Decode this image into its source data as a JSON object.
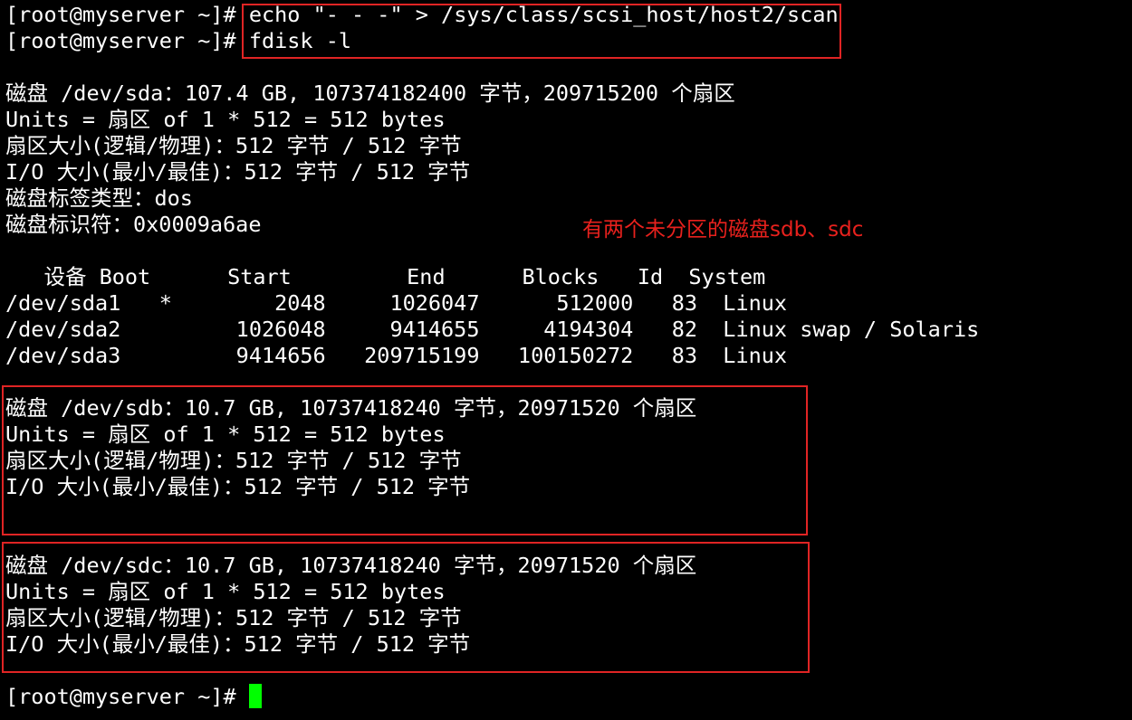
{
  "terminal": {
    "prompt": "[root@myserver ~]#",
    "commands": [
      "echo \"- - -\" > /sys/class/scsi_host/host2/scan",
      "fdisk -l"
    ],
    "sda": {
      "header": "磁盘 /dev/sda：107.4 GB, 107374182400 字节，209715200 个扇区",
      "units": "Units = 扇区 of 1 * 512 = 512 bytes",
      "sector_size": "扇区大小(逻辑/物理)：512 字节 / 512 字节",
      "io_size": "I/O 大小(最小/最佳)：512 字节 / 512 字节",
      "label_type": "磁盘标签类型：dos",
      "identifier": "磁盘标识符：0x0009a6ae"
    },
    "partition_table": {
      "header": "   设备 Boot      Start         End      Blocks   Id  System",
      "rows": [
        "/dev/sda1   *        2048     1026047      512000   83  Linux",
        "/dev/sda2         1026048     9414655     4194304   82  Linux swap / Solaris",
        "/dev/sda3         9414656   209715199   100150272   83  Linux"
      ]
    },
    "sdb": {
      "header": "磁盘 /dev/sdb：10.7 GB, 10737418240 字节，20971520 个扇区",
      "units": "Units = 扇区 of 1 * 512 = 512 bytes",
      "sector_size": "扇区大小(逻辑/物理)：512 字节 / 512 字节",
      "io_size": "I/O 大小(最小/最佳)：512 字节 / 512 字节"
    },
    "sdc": {
      "header": "磁盘 /dev/sdc：10.7 GB, 10737418240 字节，20971520 个扇区",
      "units": "Units = 扇区 of 1 * 512 = 512 bytes",
      "sector_size": "扇区大小(逻辑/物理)：512 字节 / 512 字节",
      "io_size": "I/O 大小(最小/最佳)：512 字节 / 512 字节"
    }
  },
  "annotation": {
    "text": "有两个未分区的磁盘sdb、sdc",
    "color": "#e8211d"
  },
  "colors": {
    "background": "#000000",
    "text": "#ffffff",
    "highlight_box": "#e02424",
    "cursor": "#00ff00"
  }
}
